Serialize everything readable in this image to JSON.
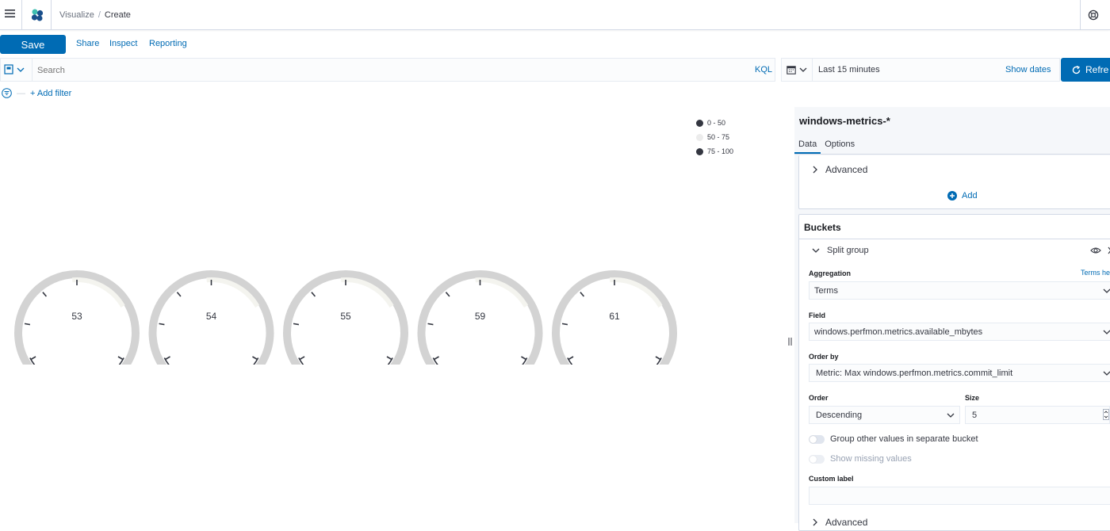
{
  "header": {
    "breadcrumb_root": "Visualize",
    "breadcrumb_sep": "/",
    "breadcrumb_current": "Create"
  },
  "toolbar": {
    "save_label": "Save",
    "share_label": "Share",
    "inspect_label": "Inspect",
    "reporting_label": "Reporting"
  },
  "query": {
    "placeholder": "Search",
    "language": "KQL"
  },
  "time": {
    "range": "Last 15 minutes",
    "show_dates": "Show dates",
    "refresh_label": "Refre"
  },
  "filters": {
    "add_filter": "+ Add filter"
  },
  "legend": [
    {
      "label": "0 - 50",
      "color": "#343741"
    },
    {
      "label": "50 - 75",
      "color": "#ececec"
    },
    {
      "label": "75 - 100",
      "color": "#343741"
    }
  ],
  "gauges": [
    {
      "value": "53"
    },
    {
      "value": "54"
    },
    {
      "value": "55"
    },
    {
      "value": "59"
    },
    {
      "value": "61"
    }
  ],
  "editor": {
    "index_pattern": "windows-metrics-*",
    "tabs": [
      {
        "label": "Data",
        "active": true
      },
      {
        "label": "Options",
        "active": false
      }
    ],
    "metrics_advanced": "Advanced",
    "add_label": "Add",
    "buckets_title": "Buckets",
    "split_group": "Split group",
    "aggregation_label": "Aggregation",
    "aggregation_help": "Terms he",
    "aggregation_value": "Terms",
    "field_label": "Field",
    "field_value": "windows.perfmon.metrics.available_mbytes",
    "orderby_label": "Order by",
    "orderby_value": "Metric: Max windows.perfmon.metrics.commit_limit",
    "order_label": "Order",
    "order_value": "Descending",
    "size_label": "Size",
    "size_value": "5",
    "group_other": "Group other values in separate bucket",
    "show_missing": "Show missing values",
    "custom_label": "Custom label",
    "bucket_advanced": "Advanced"
  },
  "colors": {
    "accent": "#006bb4",
    "gauge_track": "#d3d3d3",
    "gauge_dark": "#343741"
  }
}
